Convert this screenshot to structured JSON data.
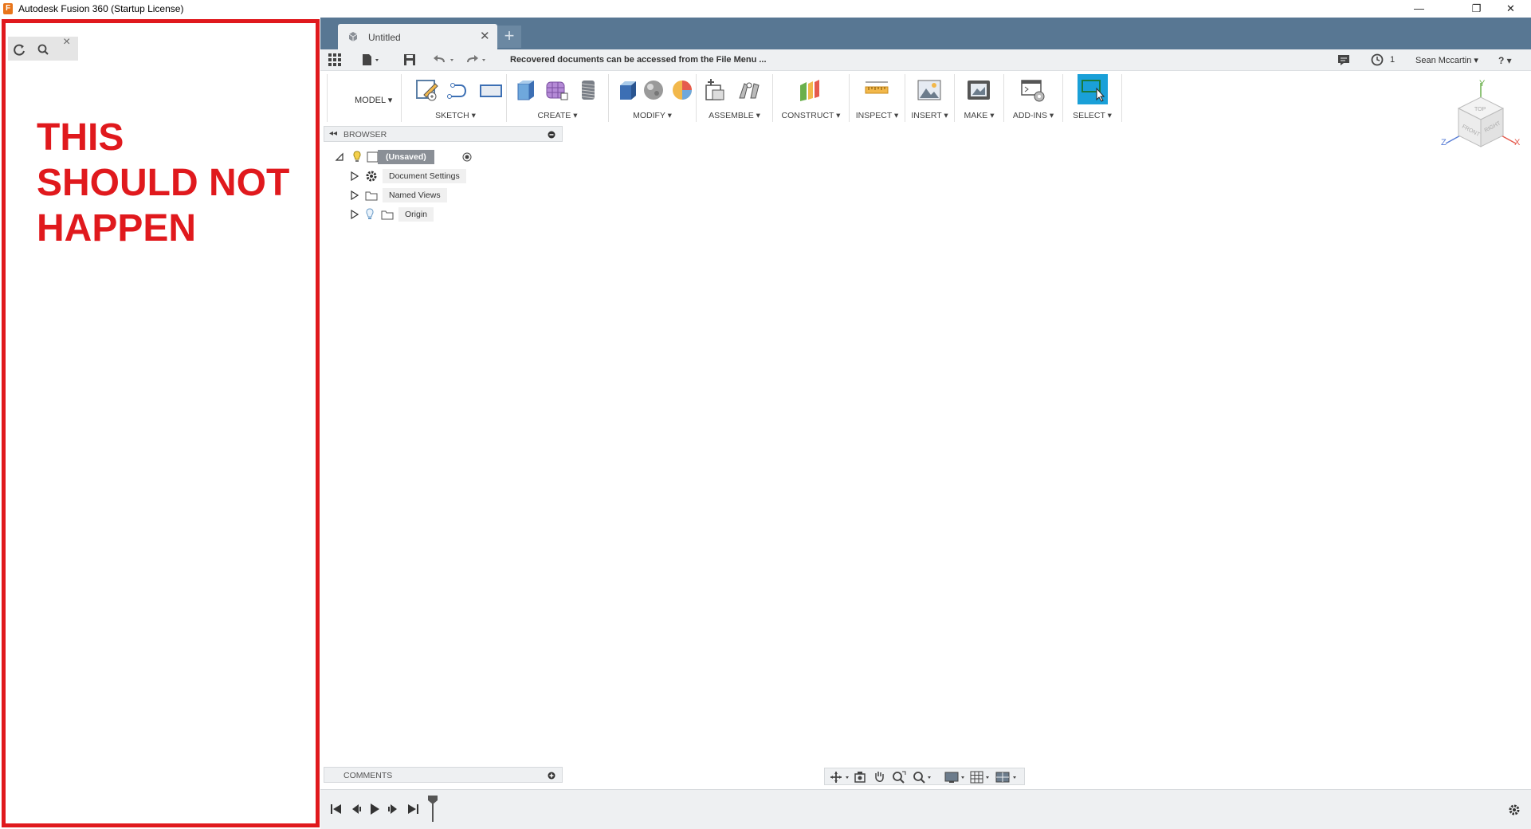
{
  "window": {
    "title": "Autodesk Fusion 360 (Startup License)",
    "logo_letter": "F",
    "minimize": "—",
    "restore": "❐",
    "close": "✕"
  },
  "overlay": {
    "warning": "THIS\nSHOULD NOT\nHAPPEN",
    "color": "#e0191d"
  },
  "left_panel": {
    "close": "×"
  },
  "tabs": {
    "active": "Untitled",
    "close": "✕",
    "new": "+"
  },
  "qat": {
    "message": "Recovered documents can be accessed from the File Menu ...",
    "jobs": "1",
    "user": "Sean Mccartin ▾",
    "help": "? ▾"
  },
  "toolbar": {
    "workspace": "MODEL ▾",
    "groups": [
      "SKETCH ▾",
      "CREATE ▾",
      "MODIFY ▾",
      "ASSEMBLE ▾",
      "CONSTRUCT ▾",
      "INSPECT ▾",
      "INSERT ▾",
      "MAKE ▾",
      "ADD-INS ▾",
      "SELECT ▾"
    ]
  },
  "browser": {
    "title": "BROWSER",
    "root": "(Unsaved)",
    "items": [
      "Document Settings",
      "Named Views",
      "Origin"
    ]
  },
  "viewcube": {
    "top": "TOP",
    "front": "FRONT",
    "right": "RIGHT",
    "axis_x": "X",
    "axis_y": "Y",
    "axis_z": "Z"
  },
  "comments": {
    "title": "COMMENTS"
  },
  "colors": {
    "tabbar": "#587793",
    "accent_select": "#1aa0d8"
  }
}
